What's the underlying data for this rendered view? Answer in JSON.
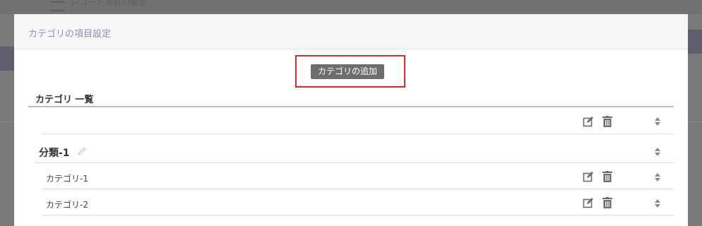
{
  "background": {
    "title": "レコード項目の設定"
  },
  "modal": {
    "title": "カテゴリの項目設定",
    "add_button_label": "カテゴリの追加",
    "list_heading": "カテゴリ 一覧"
  },
  "group": {
    "label": "分類-1"
  },
  "categories": [
    {
      "label": "カテゴリ-1"
    },
    {
      "label": "カテゴリ-2"
    }
  ],
  "colors": {
    "title_accent": "#9b83c4",
    "highlight": "#d62b2b",
    "button_bg": "#6e6e6e"
  },
  "icons": [
    "edit-icon",
    "trash-icon",
    "sort-icon",
    "pencil-icon"
  ]
}
